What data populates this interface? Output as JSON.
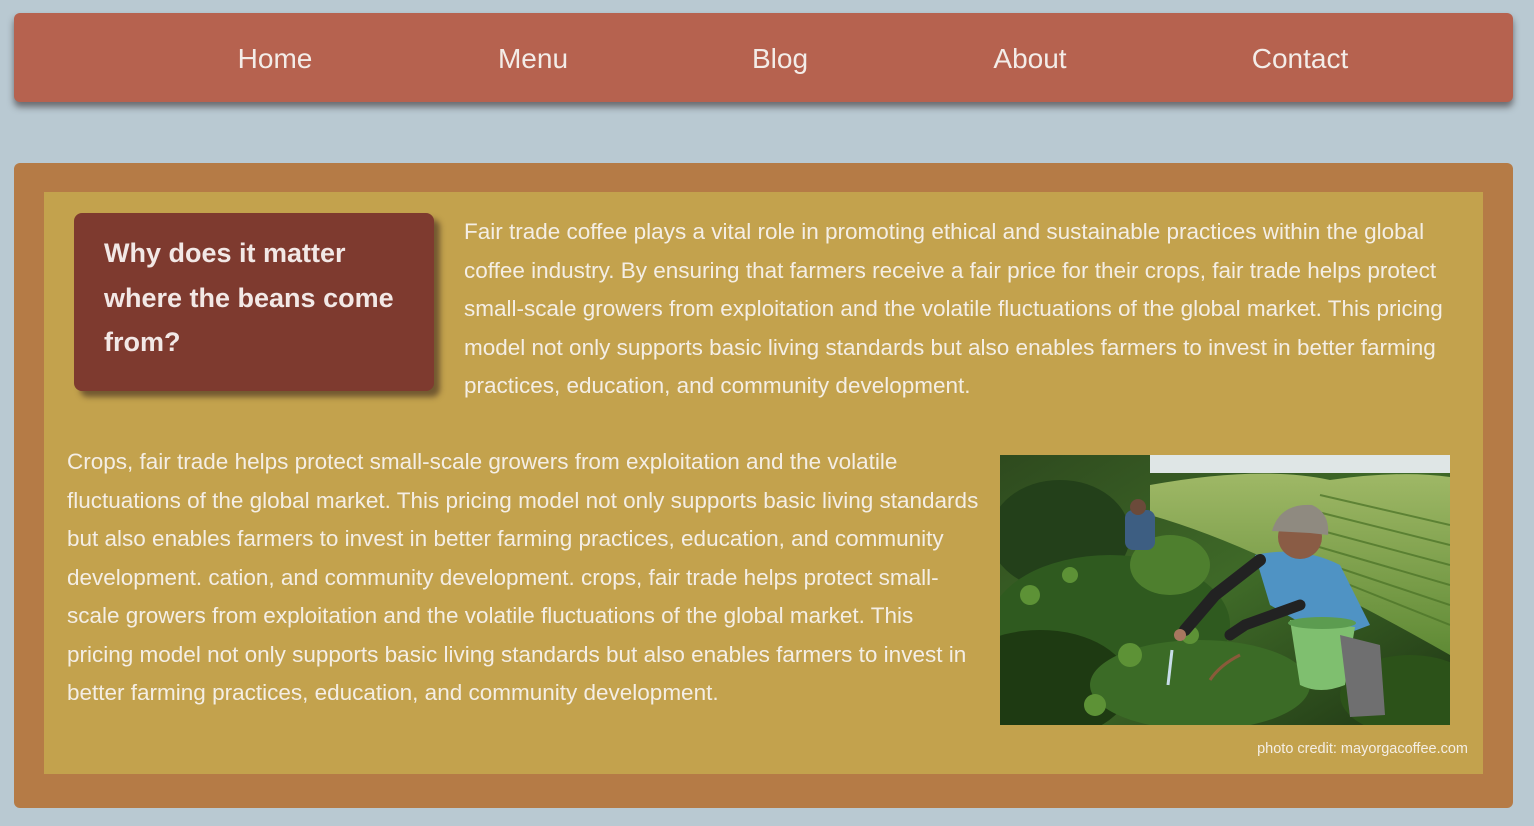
{
  "nav": {
    "items": [
      {
        "label": "Home"
      },
      {
        "label": "Menu"
      },
      {
        "label": "Blog"
      },
      {
        "label": "About"
      },
      {
        "label": "Contact"
      }
    ]
  },
  "article": {
    "question": "Why does it matter where the beans come from?",
    "intro": "Fair trade coffee plays a vital role in promoting ethical and sustainable practices within the global coffee industry. By ensuring that farmers receive a fair price for their crops, fair trade helps protect small-scale growers from exploitation and the volatile fluctuations of the global market. This pricing model not only supports basic living standards but also enables farmers to invest in better farming practices, education, and community development.",
    "body": "Crops, fair trade helps protect small-scale growers from exploitation and the volatile fluctuations of the global market. This pricing model not only supports basic living standards but also enables farmers to invest in better farming practices, education, and community development. cation, and community development. crops, fair trade helps protect small-scale growers from exploitation and the volatile fluctuations of the global market. This pricing model not only supports basic living standards but also enables farmers to invest in better farming practices, education, and community development.",
    "photo_credit": "photo credit: mayorgacoffee.com"
  },
  "colors": {
    "page_background": "#b9c9d2",
    "nav_background": "#b6624f",
    "outer_panel": "#b57b46",
    "inner_panel": "#c3a24d",
    "question_box": "#7e3a2f",
    "text_light": "#f4eee5"
  }
}
